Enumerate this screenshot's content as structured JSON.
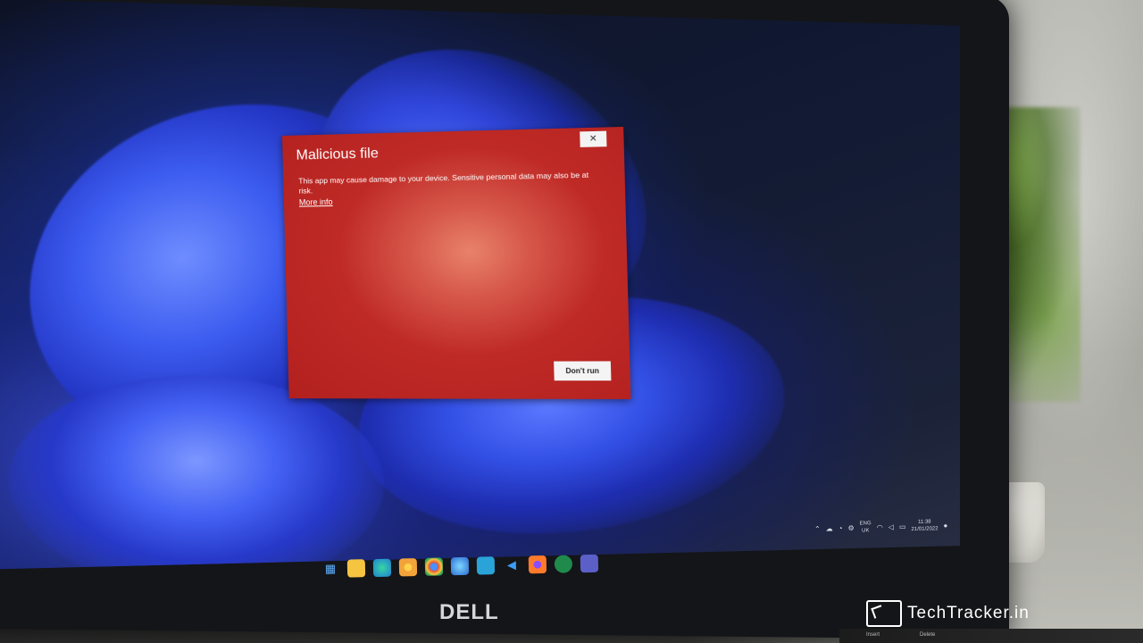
{
  "dialog": {
    "title": "Malicious file",
    "message": "This app may cause damage to your device. Sensitive personal data may also be at risk.",
    "link": "More info",
    "close_glyph": "✕",
    "primary_button": "Don't run"
  },
  "taskbar": {
    "icons": [
      "windows-start-icon",
      "file-explorer-icon",
      "edge-icon",
      "chrome-canary-icon",
      "chrome-icon",
      "edge-dev-icon",
      "store-icon",
      "vscode-icon",
      "firefox-icon",
      "app-icon",
      "teams-icon"
    ]
  },
  "tray": {
    "lang_top": "ENG",
    "lang_bottom": "UK",
    "time": "11:38",
    "date": "21/01/2022"
  },
  "hardware": {
    "brand": "DELL",
    "key_insert": "Insert",
    "key_delete": "Delete"
  },
  "watermark": {
    "text": "TechTracker.in"
  },
  "colors": {
    "dialog_red": "#bf2a26",
    "wallpaper_blue": "#3c5cf0"
  }
}
